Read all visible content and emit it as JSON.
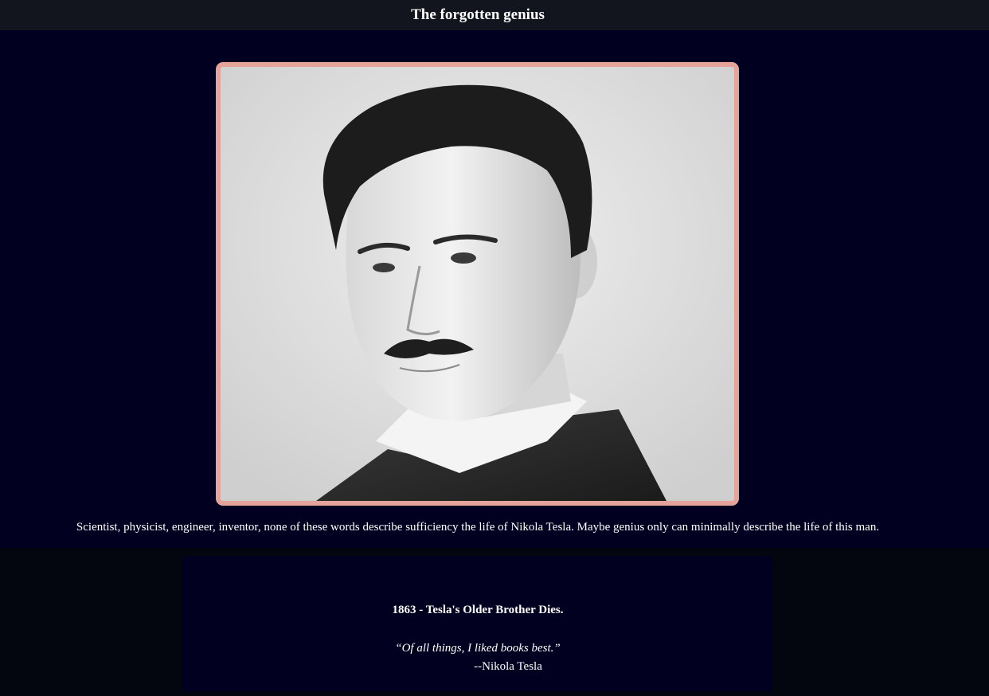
{
  "header": {
    "title": "The forgotten genius"
  },
  "hero": {
    "portrait_alt": "Portrait photograph of Nikola Tesla",
    "caption": "Scientist, physicist, engineer, inventor, none of these words describe sufficiency the life of Nikola Tesla. Maybe genius only can minimally describe the life of this man."
  },
  "timeline": {
    "event_title": "1863 - Tesla's Older Brother Dies.",
    "quote": "“Of all things, I liked books best.”",
    "author": "--Nikola Tesla"
  },
  "colors": {
    "header_bg": "#13151e",
    "hero_bg": "#010021",
    "frame_border": "#e4a49a",
    "page_bg": "#03050f"
  }
}
